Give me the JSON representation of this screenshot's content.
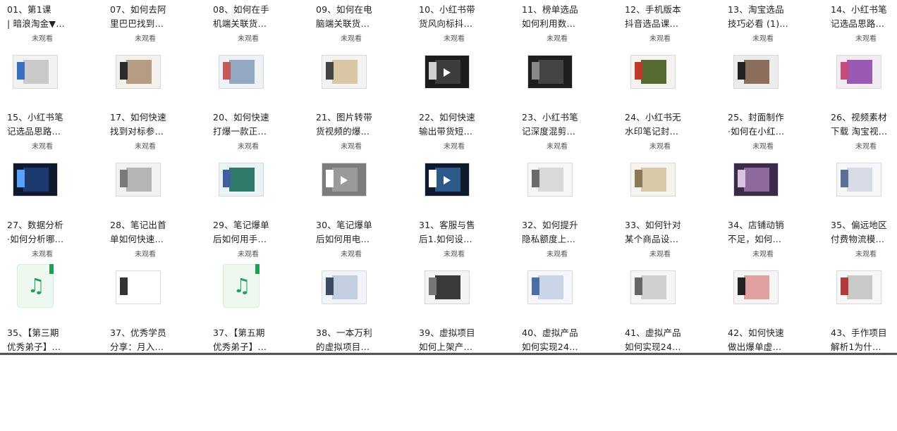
{
  "status_label": "未观看",
  "rows": [
    [
      {
        "title": "01、第1课 | 暗浪淘金▼…",
        "thumb": {
          "bg": "#f2f2f2",
          "mid": "#c9c9c9",
          "accent": "#3a6fbf"
        }
      },
      {
        "title": "07、如何去阿里巴巴找到…",
        "thumb": {
          "bg": "#f4f1ec",
          "mid": "#b49c85",
          "accent": "#2b2b2b"
        }
      },
      {
        "title": "08、如何在手机端关联货…",
        "thumb": {
          "bg": "#eef2f6",
          "mid": "#93a9c2",
          "accent": "#c45a5a"
        }
      },
      {
        "title": "09、如何在电脑端关联货…",
        "thumb": {
          "bg": "#f3f3f3",
          "mid": "#d9c6a5",
          "accent": "#444444"
        }
      },
      {
        "title": "10、小红书带货风向标抖…",
        "thumb": {
          "bg": "#1c1c1c",
          "mid": "#3c3c3c",
          "accent": "#d0d0d0"
        },
        "play": true
      },
      {
        "title": "11、榜单选品如何利用数…",
        "thumb": {
          "bg": "#1e1e1e",
          "mid": "#444444",
          "accent": "#888888"
        }
      },
      {
        "title": "12、手机版本抖音选品课…",
        "thumb": {
          "bg": "#f6f3f0",
          "mid": "#556b2f",
          "accent": "#c0392b"
        }
      },
      {
        "title": "13、淘宝选品技巧必看 (1)…",
        "thumb": {
          "bg": "#ececec",
          "mid": "#8a6d5a",
          "accent": "#222222"
        }
      },
      {
        "title": "14、小红书笔记选品思路…",
        "thumb": {
          "bg": "#f1ecf4",
          "mid": "#9b59b6",
          "accent": "#c94b7d"
        }
      }
    ],
    [
      {
        "title": "15、小红书笔记选品思路…",
        "thumb": {
          "bg": "#0f1a2e",
          "mid": "#1c3a6e",
          "accent": "#5aa0ff"
        }
      },
      {
        "title": "17、如何快速找到对标参…",
        "thumb": {
          "bg": "#f2f2f2",
          "mid": "#b5b5b5",
          "accent": "#7a7a7a"
        }
      },
      {
        "title": "20、如何快速打爆一款正…",
        "thumb": {
          "bg": "#eaf3f3",
          "mid": "#2f7a6b",
          "accent": "#3f5fa0"
        }
      },
      {
        "title": "21、图片转带货视频的爆…",
        "thumb": {
          "bg": "#7d7d7d",
          "mid": "#9a9a9a",
          "accent": "#ffffff"
        },
        "play": true
      },
      {
        "title": "22、如何快速输出带货短…",
        "thumb": {
          "bg": "#0e1a2c",
          "mid": "#2d5a8a",
          "accent": "#ffffff"
        },
        "play": true
      },
      {
        "title": "23、小红书笔记深度混剪…",
        "thumb": {
          "bg": "#f7f7f7",
          "mid": "#d9d9d9",
          "accent": "#6b6b6b"
        }
      },
      {
        "title": "24、小红书无水印笔记封…",
        "thumb": {
          "bg": "#f6f4ef",
          "mid": "#d8c8a8",
          "accent": "#8a7a5a"
        }
      },
      {
        "title": "25、封面制作·如何在小红…",
        "thumb": {
          "bg": "#3b2a4a",
          "mid": "#8e6a9c",
          "accent": "#d9c2e0"
        }
      },
      {
        "title": "26、视频素材下载 淘宝视…",
        "thumb": {
          "bg": "#f7f7f9",
          "mid": "#d6dbe6",
          "accent": "#5d6f94"
        }
      }
    ],
    [
      {
        "title": "27、数据分析·如何分析哪…",
        "music": true
      },
      {
        "title": "28、笔记出首单如何快速…",
        "thumb": {
          "bg": "#ffffff",
          "mid": "#ffffff",
          "accent": "#333333"
        }
      },
      {
        "title": "29、笔记爆单后如何用手…",
        "music": true
      },
      {
        "title": "30、笔记爆单后如何用电…",
        "thumb": {
          "bg": "#f1f3f6",
          "mid": "#c3cfe0",
          "accent": "#3c4b64"
        }
      },
      {
        "title": "31、客服与售后1.如何设…",
        "thumb": {
          "bg": "#f4f4f4",
          "mid": "#3a3a3a",
          "accent": "#777777"
        }
      },
      {
        "title": "32、如何提升隐私额度上…",
        "thumb": {
          "bg": "#f5f7fa",
          "mid": "#c9d6e8",
          "accent": "#4a6fa5"
        }
      },
      {
        "title": "33、如何针对某个商品设…",
        "thumb": {
          "bg": "#f6f6f6",
          "mid": "#d0d0d0",
          "accent": "#666666"
        }
      },
      {
        "title": "34、店铺动销不足，如何…",
        "thumb": {
          "bg": "#f5f5f5",
          "mid": "#e0a0a0",
          "accent": "#222222"
        }
      },
      {
        "title": "35、偏远地区付费物流模…",
        "thumb": {
          "bg": "#f7f7f7",
          "mid": "#c9c9c9",
          "accent": "#b23a3a"
        }
      }
    ],
    [
      {
        "title": "35、【第三期优秀弟子】…"
      },
      {
        "title": "37、优秀学员分享：月入…"
      },
      {
        "title": "37、【第五期优秀弟子】…"
      },
      {
        "title": "38、一本万利的虚拟项目…"
      },
      {
        "title": "39、虚拟项目如何上架产…"
      },
      {
        "title": "40、虚拟产品如何实现24…"
      },
      {
        "title": "41、虚拟产品如何实现24…"
      },
      {
        "title": "42、如何快速做出爆单虚…"
      },
      {
        "title": "43、手作项目解析1为什…"
      }
    ]
  ],
  "icons": {
    "play": "play-icon",
    "audio": "audio-file-icon"
  }
}
